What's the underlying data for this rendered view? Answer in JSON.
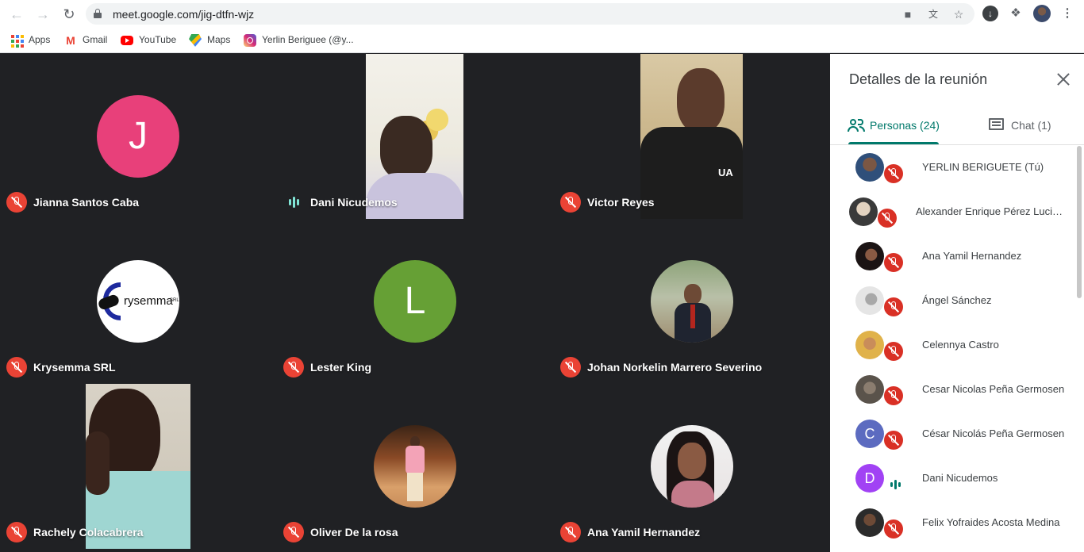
{
  "browser": {
    "url": "meet.google.com/jig-dtfn-wjz",
    "bookmarks": [
      {
        "label": "Apps",
        "icon": "apps-grid-icon"
      },
      {
        "label": "Gmail",
        "icon": "gmail-icon"
      },
      {
        "label": "YouTube",
        "icon": "youtube-icon"
      },
      {
        "label": "Maps",
        "icon": "maps-icon"
      },
      {
        "label": "Yerlin Beriguee (@y...",
        "icon": "instagram-icon"
      }
    ]
  },
  "tiles": [
    {
      "name": "Jianna Santos Caba",
      "mic": "muted",
      "avatar": "J",
      "avatar_color": "#e8407a"
    },
    {
      "name": "Dani Nicudemos",
      "mic": "speaking"
    },
    {
      "name": "Victor Reyes",
      "mic": "muted"
    },
    {
      "name": "Krysemma SRL",
      "mic": "muted",
      "logo_text": "rysemma",
      "logo_suffix": "SRL"
    },
    {
      "name": "Lester King",
      "mic": "muted",
      "avatar": "L",
      "avatar_color": "#66a035"
    },
    {
      "name": "Johan Norkelin Marrero Severino",
      "mic": "muted"
    },
    {
      "name": "Rachely Colacabrera",
      "mic": "muted"
    },
    {
      "name": "Oliver De la rosa",
      "mic": "muted"
    },
    {
      "name": "Ana Yamil Hernandez",
      "mic": "muted"
    }
  ],
  "panel": {
    "title": "Detalles de la reunión",
    "tabs": [
      {
        "label": "Personas (24)",
        "active": true
      },
      {
        "label": "Chat (1)",
        "active": false
      }
    ],
    "people": [
      {
        "name": "YERLIN BERIGUETE (Tú)",
        "mic": "muted"
      },
      {
        "name": "Alexander Enrique Pérez Luciano",
        "mic": "muted"
      },
      {
        "name": "Ana Yamil Hernandez",
        "mic": "muted"
      },
      {
        "name": "Ángel Sánchez",
        "mic": "muted"
      },
      {
        "name": "Celennya Castro",
        "mic": "muted"
      },
      {
        "name": "Cesar Nicolas Peña Germosen",
        "mic": "muted"
      },
      {
        "name": "César Nicolás Peña Germosen",
        "mic": "muted",
        "avatar": "C",
        "avatar_color": "#5c6bc0"
      },
      {
        "name": "Dani Nicudemos",
        "mic": "speaking",
        "avatar": "D",
        "avatar_color": "#a142f4"
      },
      {
        "name": "Felix Yofraides Acosta Medina",
        "mic": "muted"
      }
    ]
  },
  "colors": {
    "accent": "#00796b",
    "muted_red": "#ea4335",
    "stage_bg": "#202124"
  }
}
